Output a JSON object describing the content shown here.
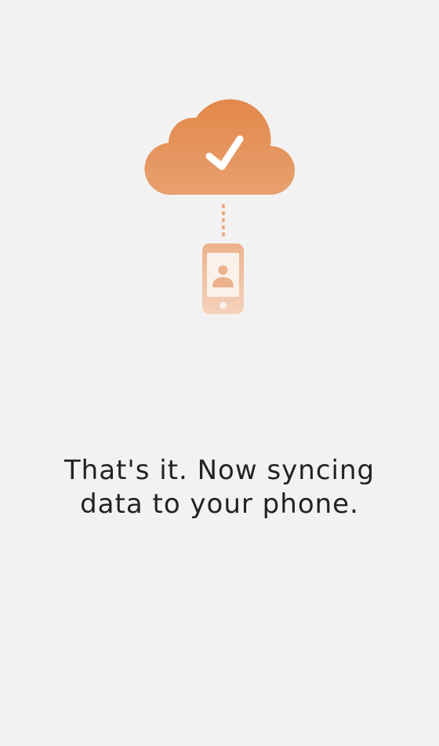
{
  "screen": {
    "background": "#f2f2f2",
    "accent_color": "#e3884a",
    "illustration": {
      "cloud_icon": "cloud-check-icon",
      "connector": "dashed-line",
      "phone_icon": "phone-contact-icon"
    },
    "message": {
      "line1": "That's it. Now syncing",
      "line2": "data to your phone."
    }
  }
}
